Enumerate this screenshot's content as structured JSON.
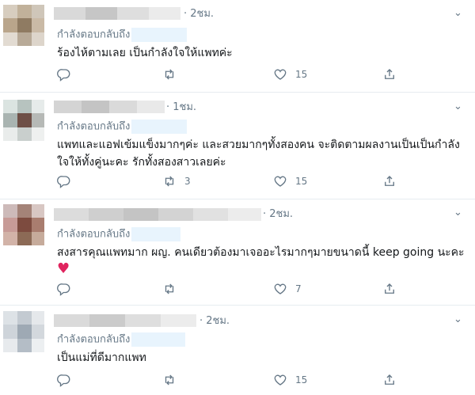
{
  "reply_prefix": "กำลังตอบกลับถึง",
  "tweets": [
    {
      "time": "· 2ชม.",
      "text": "ร้องไห้ตามเลย เป็นกำลังใจให้แพทค่ะ",
      "extra": "",
      "retweets": "",
      "likes": "15"
    },
    {
      "time": "· 1ชม.",
      "text": "แพทและแอฟเข้มแข็งมากๆค่ะ และสวยมากๆทั้งสองคน จะติดตามผลงานเป็นเป็นกำลังใจให้ทั้งคู่นะคะ รักทั้งสองสาวเลยค่ะ",
      "extra": "",
      "retweets": "3",
      "likes": "15"
    },
    {
      "time": "· 2ชม.",
      "text": "สงสารคุณแพทมาก ผญ. คนเดียวต้องมาเจออะไรมากๆมายขนาดนี้  keep going นะคะ",
      "extra": "♥",
      "retweets": "",
      "likes": "7"
    },
    {
      "time": "· 2ชม.",
      "text": "เป็นแม่ที่ดีมากแพท",
      "extra": "",
      "retweets": "",
      "likes": "15"
    }
  ],
  "icons": {
    "reply": "reply-icon",
    "retweet": "retweet-icon",
    "like": "heart-icon",
    "share": "share-icon",
    "menu": "chevron-down-icon"
  },
  "colors": {
    "muted": "#657786",
    "heart": "#e0245e",
    "mention_bg": "#e8f4fd"
  }
}
